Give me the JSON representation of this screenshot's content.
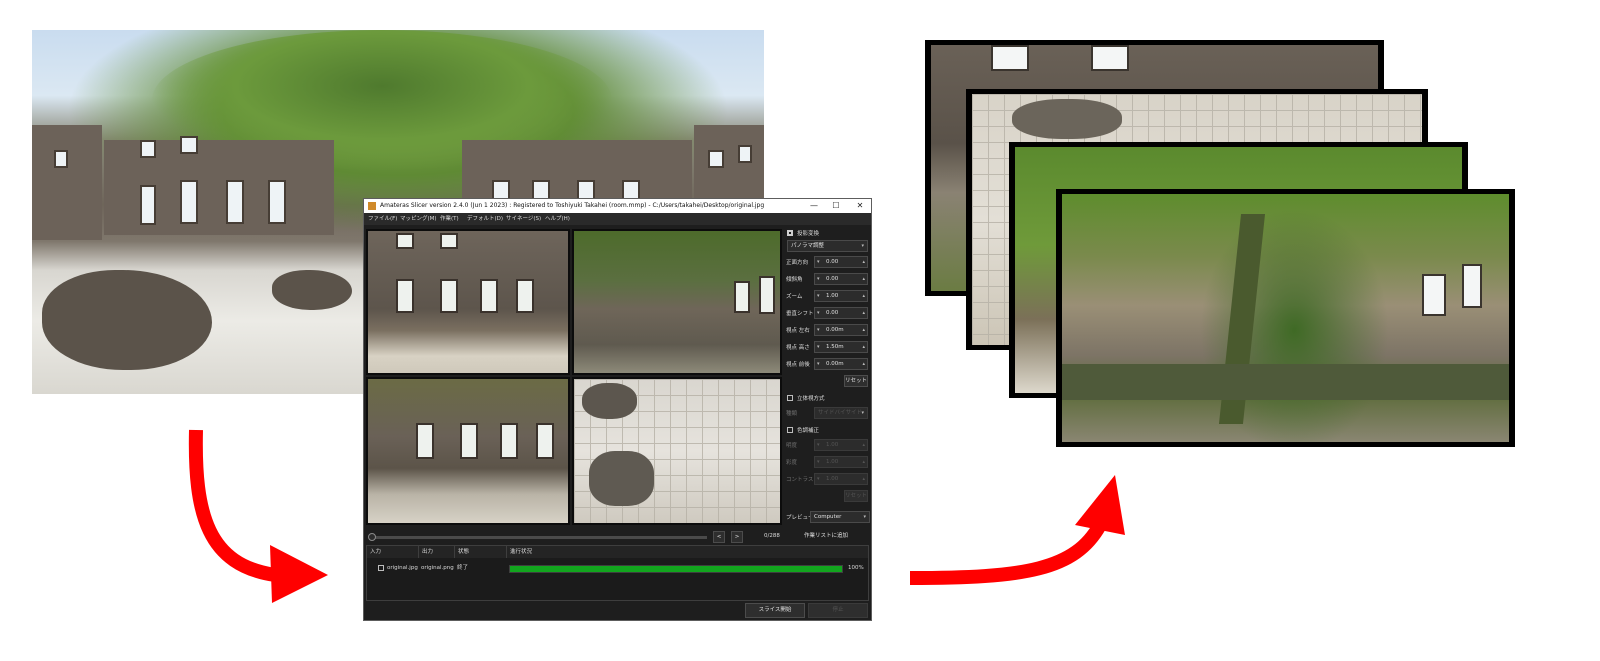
{
  "app": {
    "title": "Amateras Slicer version 2.4.0 (Jun  1 2023) : Registered to Toshiyuki Takahei (room.mmp) - C:/Users/takahei/Desktop/original.jpg",
    "window_controls": {
      "minimize": "—",
      "maximize": "☐",
      "close": "✕"
    }
  },
  "menu": [
    "ファイル(F)",
    "マッピング(M)",
    "作業(T)",
    "デフォルト(D)",
    "サイネージ(S)",
    "ヘルプ(H)"
  ],
  "panel": {
    "projection_label": "投影変換",
    "projection_checked": true,
    "mode": "パノラマ調整",
    "params": [
      {
        "label": "正面方向",
        "value": "0.00"
      },
      {
        "label": "傾斜角",
        "value": "0.00"
      },
      {
        "label": "ズーム",
        "value": "1.00"
      },
      {
        "label": "垂直シフト",
        "value": "0.00"
      },
      {
        "label": "視点 左右",
        "value": "0.00m"
      },
      {
        "label": "視点 高さ",
        "value": "1.50m"
      },
      {
        "label": "視点 前後",
        "value": "0.00m"
      }
    ],
    "reset_label": "リセット",
    "stereo_label": "立体視方式",
    "stereo_checked": false,
    "stereo_type_label": "種類",
    "stereo_type_value": "サイドバイサイド",
    "color_label": "色調補正",
    "color_checked": false,
    "color_params": [
      {
        "label": "明度",
        "value": "1.00"
      },
      {
        "label": "彩度",
        "value": "1.00"
      },
      {
        "label": "コントラスト",
        "value": "1.00"
      }
    ],
    "color_reset_label": "リセット",
    "preview_label": "プレビュー",
    "preview_value": "Computer"
  },
  "nav": {
    "prev": "<",
    "next": ">",
    "frame_counter": "0/288",
    "add_to_list_label": "作業リストに追加"
  },
  "task_table": {
    "columns": [
      "入力",
      "出力",
      "状態",
      "進行状況"
    ],
    "rows": [
      {
        "input": "original.jpg",
        "output": "original.png",
        "status": "終了",
        "progress": 100,
        "progress_text": "100%"
      }
    ]
  },
  "footer": {
    "start_label": "スライス開始",
    "stop_label": "停止"
  },
  "colors": {
    "arrow": "#ff0000",
    "progress": "#12a51e",
    "window_bg": "#1e1e1e"
  }
}
